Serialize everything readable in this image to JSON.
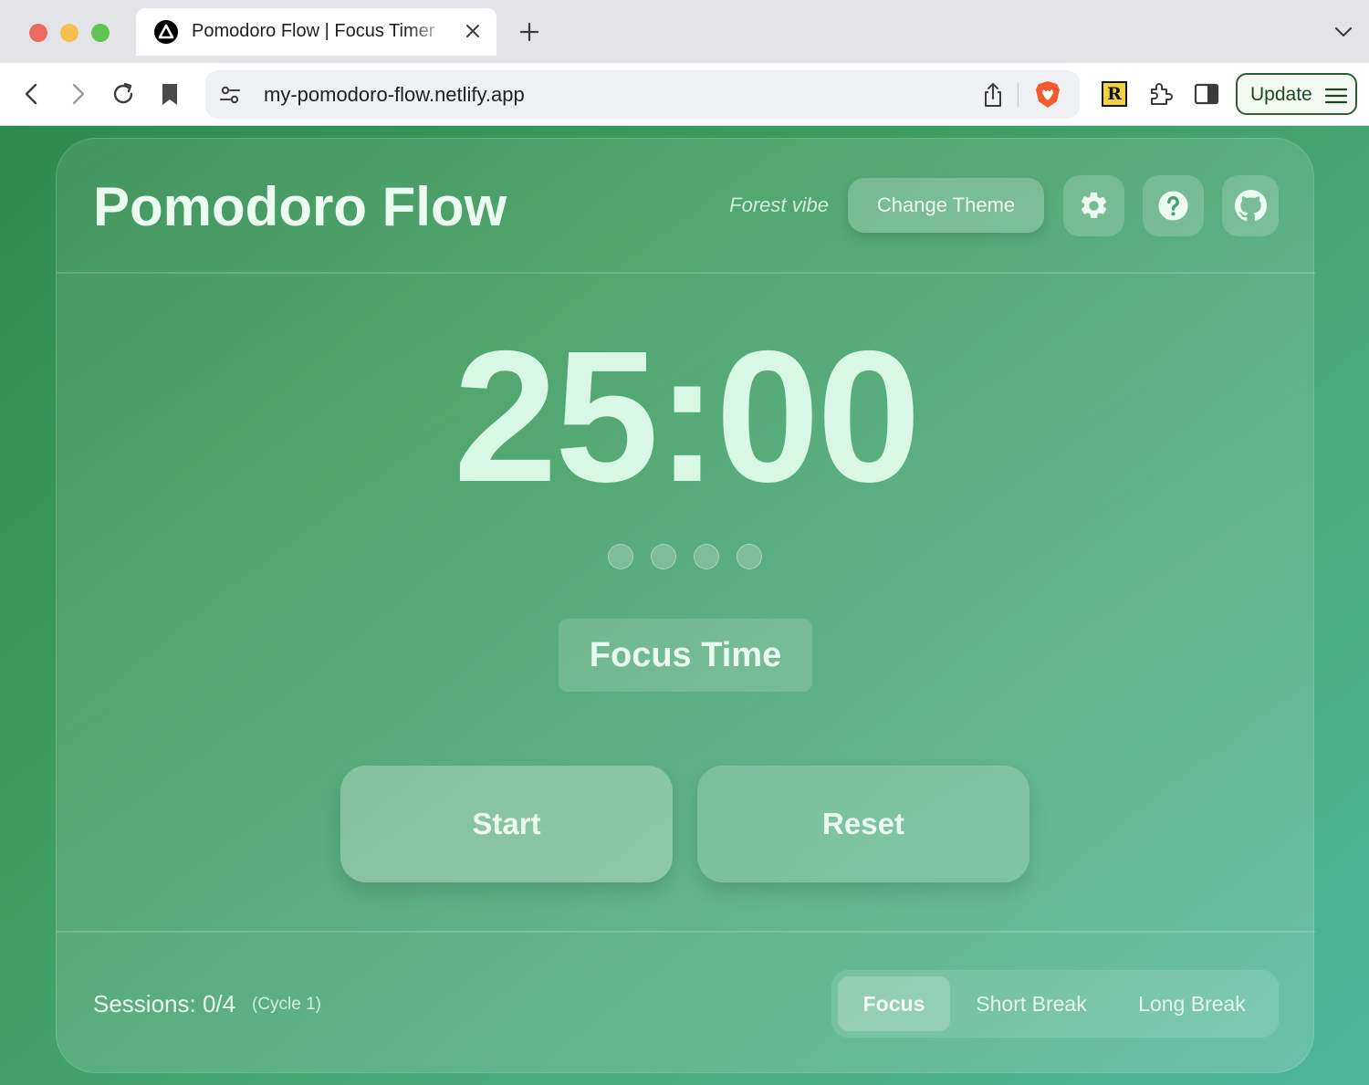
{
  "browser": {
    "tab_title": "Pomodoro Flow | Focus Timer",
    "url": "my-pomodoro-flow.netlify.app",
    "extension_label": "R",
    "update_label": "Update",
    "icons": [
      "back-icon",
      "forward-icon",
      "reload-icon",
      "bookmark-icon",
      "site-settings-icon",
      "share-icon",
      "brave-shields-icon",
      "extensions-icon",
      "sidebar-icon",
      "menu-icon",
      "new-tab-icon",
      "close-icon",
      "chevron-down-icon"
    ]
  },
  "app": {
    "title": "Pomodoro Flow",
    "theme_vibe": "Forest vibe",
    "change_theme_label": "Change Theme",
    "header_icons": [
      "gear-icon",
      "help-icon",
      "github-icon"
    ],
    "timer": "25:00",
    "session_dots": 4,
    "mode_label": "Focus Time",
    "start_label": "Start",
    "reset_label": "Reset",
    "sessions_text": "Sessions: 0/4",
    "cycle_text": "(Cycle 1)",
    "modes": [
      "Focus",
      "Short Break",
      "Long Break"
    ],
    "active_mode": "Focus"
  },
  "colors": {
    "accent_text": "#d8f7e5",
    "background_start": "#2f8a4f",
    "background_end": "#4fb69c"
  }
}
